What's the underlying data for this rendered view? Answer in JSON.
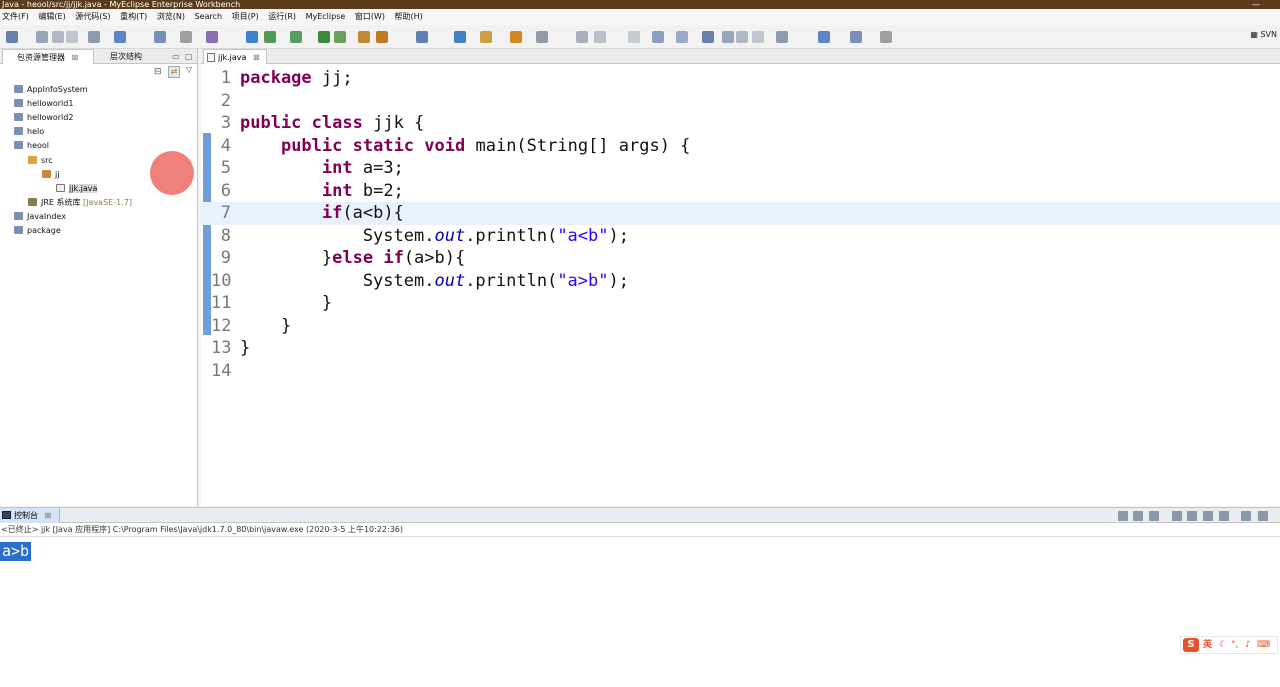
{
  "window": {
    "title": "Java - heool/src/jj/jjk.java - MyEclipse Enterprise Workbench",
    "minimize_icon": "minimize-icon"
  },
  "menu": [
    "文件(F)",
    "编辑(E)",
    "源代码(S)",
    "重构(T)",
    "浏览(N)",
    "Search",
    "项目(P)",
    "运行(R)",
    "MyEclipse",
    "窗口(W)",
    "帮助(H)"
  ],
  "toolbar": {
    "svn_label": "SVN"
  },
  "left_pane": {
    "tabs": [
      "包资源管理器",
      "层次结构"
    ],
    "tree": [
      {
        "label": "AppInfoSystem",
        "depth": 0,
        "icon": "project-icon"
      },
      {
        "label": "helloworld1",
        "depth": 0,
        "icon": "project-icon"
      },
      {
        "label": "helloworld2",
        "depth": 0,
        "icon": "project-icon"
      },
      {
        "label": "helo",
        "depth": 0,
        "icon": "project-icon"
      },
      {
        "label": "heool",
        "depth": 0,
        "icon": "project-icon"
      },
      {
        "label": "src",
        "depth": 1,
        "icon": "source-folder-icon"
      },
      {
        "label": "jj",
        "depth": 2,
        "icon": "package-icon"
      },
      {
        "label": "jjk.java",
        "depth": 3,
        "icon": "java-file-icon",
        "selected": true
      },
      {
        "label": "JRE 系统库",
        "decoration": "[JavaSE-1.7]",
        "depth": 1,
        "icon": "library-icon"
      },
      {
        "label": "JavaIndex",
        "depth": 0,
        "icon": "project-icon"
      },
      {
        "label": "package",
        "depth": 0,
        "icon": "project-icon"
      }
    ]
  },
  "editor": {
    "tab_label": "jjk.java",
    "current_line": 7,
    "lines": [
      "package jj;",
      "",
      "public class jjk {",
      "    public static void main(String[] args) {",
      "        int a=3;",
      "        int b=2;",
      "        if(a<b){",
      "            System.out.println(\"a<b\");",
      "        }else if(a>b){",
      "            System.out.println(\"a>b\");",
      "        }",
      "    }",
      "}",
      ""
    ]
  },
  "console": {
    "tab_label": "控制台",
    "info": "<已终止> jjk [Java 应用程序] C:\\Program Files\\Java\\jdk1.7.0_80\\bin\\javaw.exe  (2020-3-5 上午10:22:36)",
    "output": "a>b"
  },
  "ime": {
    "lang": "英",
    "logo": "S"
  }
}
